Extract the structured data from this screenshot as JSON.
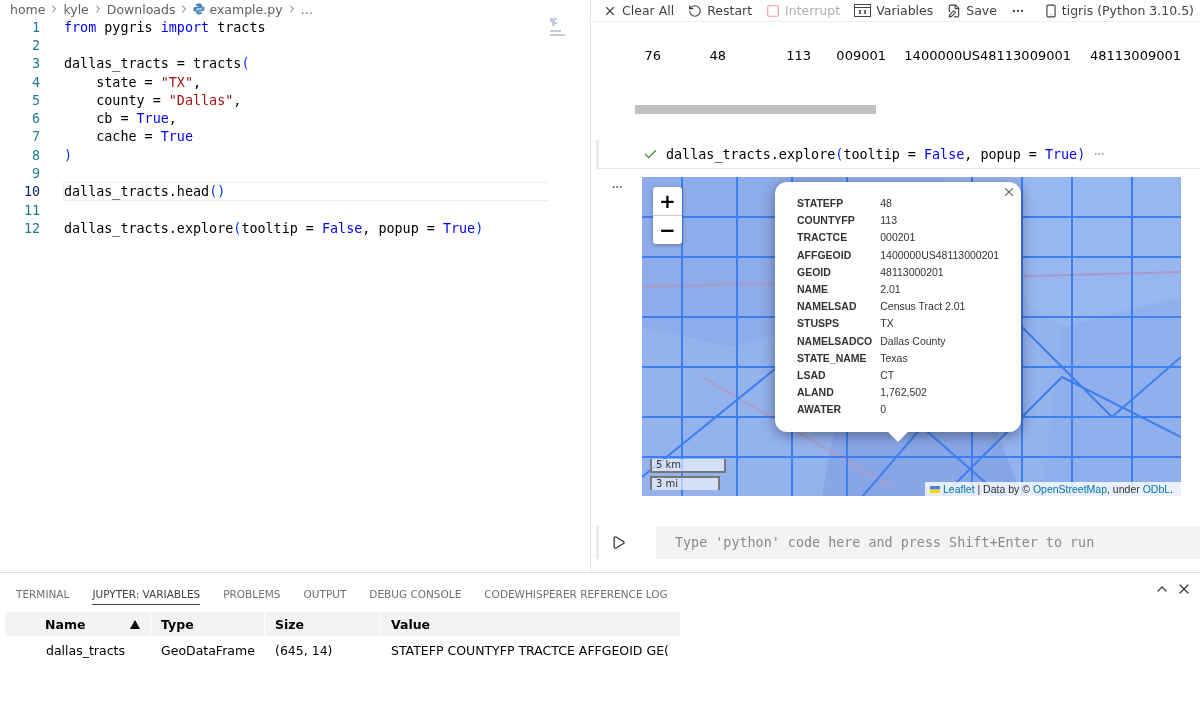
{
  "breadcrumb": [
    {
      "kind": "folder",
      "text": "home"
    },
    {
      "kind": "folder",
      "text": "kyle"
    },
    {
      "kind": "folder",
      "text": "Downloads"
    },
    {
      "kind": "python",
      "text": "example.py"
    },
    {
      "kind": "more",
      "text": "…"
    }
  ],
  "editor": {
    "lines": [
      {
        "number": "1",
        "current": false,
        "tokens": [
          {
            "kind": "kw",
            "text": "from"
          },
          {
            "kind": "plain",
            "text": " pygris "
          },
          {
            "kind": "kw",
            "text": "import"
          },
          {
            "kind": "plain",
            "text": " tracts"
          }
        ]
      },
      {
        "number": "2",
        "current": false
      },
      {
        "number": "3",
        "current": false,
        "tokens": [
          {
            "kind": "plain",
            "text": "dallas_tracts = tracts"
          },
          {
            "kind": "paren",
            "text": "("
          }
        ]
      },
      {
        "number": "4",
        "current": false,
        "tokens": [
          {
            "kind": "plain",
            "text": "    state = "
          },
          {
            "kind": "str",
            "text": "\"TX\""
          },
          {
            "kind": "plain",
            "text": ","
          }
        ]
      },
      {
        "number": "5",
        "current": false,
        "tokens": [
          {
            "kind": "plain",
            "text": "    county = "
          },
          {
            "kind": "str",
            "text": "\"Dallas\""
          },
          {
            "kind": "plain",
            "text": ","
          }
        ]
      },
      {
        "number": "6",
        "current": false,
        "tokens": [
          {
            "kind": "plain",
            "text": "    cb = "
          },
          {
            "kind": "const",
            "text": "True"
          },
          {
            "kind": "plain",
            "text": ","
          }
        ]
      },
      {
        "number": "7",
        "current": false,
        "tokens": [
          {
            "kind": "plain",
            "text": "    cache = "
          },
          {
            "kind": "const",
            "text": "True"
          }
        ]
      },
      {
        "number": "8",
        "current": false,
        "tokens": [
          {
            "kind": "paren",
            "text": ")"
          }
        ]
      },
      {
        "number": "9",
        "current": false
      },
      {
        "number": "10",
        "current": true,
        "tokens": [
          {
            "kind": "plain",
            "text": "dallas_tracts.head"
          },
          {
            "kind": "paren",
            "text": "()"
          }
        ]
      },
      {
        "number": "11",
        "current": false
      },
      {
        "number": "12",
        "current": false,
        "tokens": [
          {
            "kind": "plain",
            "text": "dallas_tracts.explore"
          },
          {
            "kind": "paren",
            "text": "("
          },
          {
            "kind": "plain",
            "text": "tooltip = "
          },
          {
            "kind": "const",
            "text": "False"
          },
          {
            "kind": "plain",
            "text": ", popup = "
          },
          {
            "kind": "const",
            "text": "True"
          },
          {
            "kind": "paren",
            "text": ")"
          }
        ]
      }
    ]
  },
  "notebook": {
    "toolbar": [
      {
        "kind": "clear",
        "label": "Clear All",
        "disabled": false
      },
      {
        "kind": "restart",
        "label": "Restart",
        "disabled": false
      },
      {
        "kind": "interrupt",
        "label": "Interrupt",
        "disabled": true
      },
      {
        "kind": "variables",
        "label": "Variables",
        "disabled": false
      },
      {
        "kind": "save",
        "label": "Save",
        "disabled": false
      }
    ],
    "kernel": "tigris (Python 3.10.5)",
    "output_row": [
      "76",
      "48",
      "113",
      "009001",
      "1400000US48113009001",
      "48113009001"
    ],
    "cell": {
      "succeeded": true,
      "tokens": [
        {
          "kind": "plain",
          "text": "dallas_tracts.explore"
        },
        {
          "kind": "paren",
          "text": "("
        },
        {
          "kind": "plain",
          "text": "tooltip = "
        },
        {
          "kind": "const",
          "text": "False"
        },
        {
          "kind": "plain",
          "text": ", popup = "
        },
        {
          "kind": "const",
          "text": "True"
        },
        {
          "kind": "paren",
          "text": ")"
        }
      ]
    },
    "map": {
      "zoom_in": "+",
      "zoom_out": "−",
      "scale": [
        "5 km",
        "3 mi"
      ],
      "popup": [
        {
          "key": "STATEFP",
          "value": "48"
        },
        {
          "key": "COUNTYFP",
          "value": "113"
        },
        {
          "key": "TRACTCE",
          "value": "000201"
        },
        {
          "key": "AFFGEOID",
          "value": "1400000US48113000201"
        },
        {
          "key": "GEOID",
          "value": "48113000201"
        },
        {
          "key": "NAME",
          "value": "2.01"
        },
        {
          "key": "NAMELSAD",
          "value": "Census Tract 2.01"
        },
        {
          "key": "STUSPS",
          "value": "TX"
        },
        {
          "key": "NAMELSADCO",
          "value": "Dallas County"
        },
        {
          "key": "STATE_NAME",
          "value": "Texas"
        },
        {
          "key": "LSAD",
          "value": "CT"
        },
        {
          "key": "ALAND",
          "value": "1,762,502"
        },
        {
          "key": "AWATER",
          "value": "0"
        }
      ],
      "attribution": [
        {
          "kind": "link",
          "text": "Leaflet"
        },
        {
          "kind": "text",
          "text": " | Data by © "
        },
        {
          "kind": "link",
          "text": "OpenStreetMap"
        },
        {
          "kind": "text",
          "text": ", under "
        },
        {
          "kind": "link",
          "text": "ODbL"
        },
        {
          "kind": "text",
          "text": "."
        }
      ]
    },
    "input_placeholder": "Type 'python' code here and press Shift+Enter to run"
  },
  "panel": {
    "tabs": [
      {
        "label": "TERMINAL",
        "selected": false
      },
      {
        "label": "JUPYTER: VARIABLES",
        "selected": true
      },
      {
        "label": "PROBLEMS",
        "selected": false
      },
      {
        "label": "OUTPUT",
        "selected": false
      },
      {
        "label": "DEBUG CONSOLE",
        "selected": false
      },
      {
        "label": "CODEWHISPERER REFERENCE LOG",
        "selected": false
      }
    ],
    "table": {
      "columns": [
        {
          "label": "Name",
          "sorted": true
        },
        {
          "label": "Type",
          "sorted": false
        },
        {
          "label": "Size",
          "sorted": false
        },
        {
          "label": "Value",
          "sorted": false
        }
      ],
      "rows": [
        [
          "dallas_tracts",
          "GeoDataFrame",
          "(645, 14)",
          "STATEFP COUNTYFP TRACTCE AFFGEOID GE("
        ]
      ]
    }
  }
}
